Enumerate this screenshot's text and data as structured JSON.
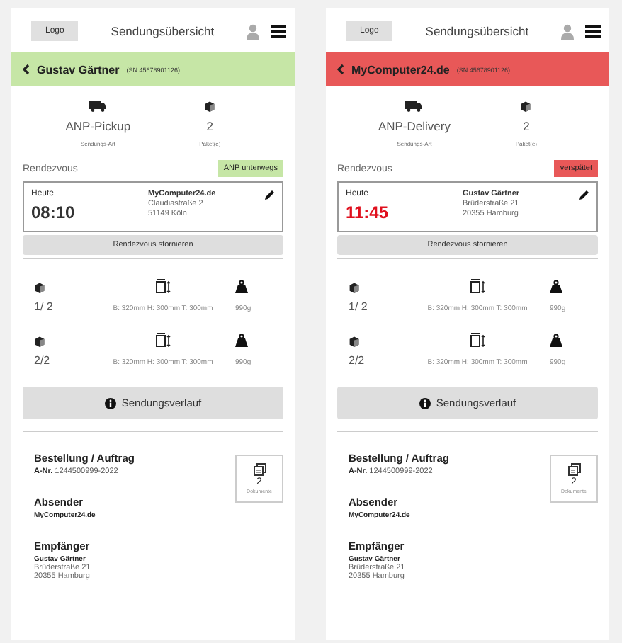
{
  "screens": [
    {
      "logo": "Logo",
      "title": "Sendungsübersicht",
      "banner": {
        "name": "Gustav Gärtner",
        "sn": "(SN 45678901126)",
        "color": "#c6e6a6"
      },
      "type": {
        "value": "ANP-Pickup",
        "label": "Sendungs-Art"
      },
      "count": {
        "value": "2",
        "label": "Paket(e)"
      },
      "rendezvous": "Rendezvous",
      "status": {
        "label": "ANP unterwegs",
        "color": "#c6e6a6"
      },
      "appointment": {
        "day": "Heute",
        "time": "08:10",
        "late": false,
        "name": "MyComputer24.de",
        "street": "Claudiastraße 2",
        "city": "51149 Köln"
      },
      "cancel": "Rendezvous stornieren",
      "parcels": [
        {
          "index": "1/ 2",
          "dims": "B: 320mm H: 300mm T: 300mm",
          "weight": "990g"
        },
        {
          "index": "2/2",
          "dims": "B: 320mm H: 300mm T: 300mm",
          "weight": "990g"
        }
      ],
      "history": "Sendungsverlauf",
      "order": {
        "heading": "Bestellung / Auftrag",
        "nr_label": "A-Nr.",
        "nr": "1244500999-2022"
      },
      "documents": {
        "count": "2",
        "label": "Dokumente"
      },
      "sender": {
        "heading": "Absender",
        "name": "MyComputer24.de"
      },
      "recipient": {
        "heading": "Empfänger",
        "name": "Gustav Gärtner",
        "street": "Brüderstraße 21",
        "city": "20355 Hamburg"
      }
    },
    {
      "logo": "Logo",
      "title": "Sendungsübersicht",
      "banner": {
        "name": "MyComputer24.de",
        "sn": "(SN 45678901126)",
        "color": "#e85858"
      },
      "type": {
        "value": "ANP-Delivery",
        "label": "Sendungs-Art"
      },
      "count": {
        "value": "2",
        "label": "Paket(e)"
      },
      "rendezvous": "Rendezvous",
      "status": {
        "label": "verspätet",
        "color": "#e85858"
      },
      "appointment": {
        "day": "Heute",
        "time": "11:45",
        "late": true,
        "name": "Gustav Gärtner",
        "street": "Brüderstraße 21",
        "city": "20355 Hamburg"
      },
      "cancel": "Rendezvous stornieren",
      "parcels": [
        {
          "index": "1/ 2",
          "dims": "B: 320mm H: 300mm T: 300mm",
          "weight": "990g"
        },
        {
          "index": "2/2",
          "dims": "B: 320mm H: 300mm T: 300mm",
          "weight": "990g"
        }
      ],
      "history": "Sendungsverlauf",
      "order": {
        "heading": "Bestellung / Auftrag",
        "nr_label": "A-Nr.",
        "nr": "1244500999-2022"
      },
      "documents": {
        "count": "2",
        "label": "Dokumente"
      },
      "sender": {
        "heading": "Absender",
        "name": "MyComputer24.de"
      },
      "recipient": {
        "heading": "Empfänger",
        "name": "Gustav Gärtner",
        "street": "Brüderstraße 21",
        "city": "20355 Hamburg"
      }
    }
  ]
}
